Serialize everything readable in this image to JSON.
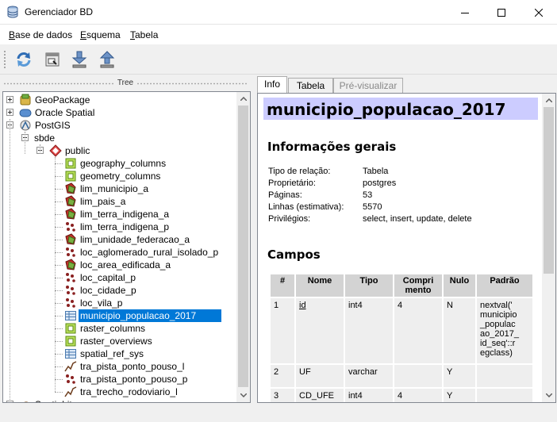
{
  "window": {
    "title": "Gerenciador BD"
  },
  "menu": {
    "items": [
      {
        "label": "Base de dados",
        "mnemonic": "B",
        "rest": "ase de dados"
      },
      {
        "label": "Esquema",
        "mnemonic": "E",
        "rest": "squema"
      },
      {
        "label": "Tabela",
        "mnemonic": "T",
        "rest": "abela"
      }
    ]
  },
  "toolbar": {
    "buttons": [
      "refresh-icon",
      "sql-window-icon",
      "import-icon",
      "export-icon"
    ]
  },
  "tree": {
    "header": "Tree",
    "items": [
      {
        "label": "GeoPackage",
        "icon": "geopackage-icon"
      },
      {
        "label": "Oracle Spatial",
        "icon": "oracle-icon"
      },
      {
        "label": "PostGIS",
        "icon": "postgis-icon"
      },
      {
        "label": "sbde",
        "icon": "connection"
      },
      {
        "label": "public",
        "icon": "schema-icon"
      },
      {
        "label": "geography_columns",
        "icon": "view-icon"
      },
      {
        "label": "geometry_columns",
        "icon": "view-icon"
      },
      {
        "label": "lim_municipio_a",
        "icon": "polygon-layer-icon"
      },
      {
        "label": "lim_pais_a",
        "icon": "polygon-layer-icon"
      },
      {
        "label": "lim_terra_indigena_a",
        "icon": "polygon-layer-icon"
      },
      {
        "label": "lim_terra_indigena_p",
        "icon": "point-layer-icon"
      },
      {
        "label": "lim_unidade_federacao_a",
        "icon": "polygon-layer-icon"
      },
      {
        "label": "loc_aglomerado_rural_isolado_p",
        "icon": "point-layer-icon"
      },
      {
        "label": "loc_area_edificada_a",
        "icon": "polygon-layer-icon"
      },
      {
        "label": "loc_capital_p",
        "icon": "point-layer-icon"
      },
      {
        "label": "loc_cidade_p",
        "icon": "point-layer-icon"
      },
      {
        "label": "loc_vila_p",
        "icon": "point-layer-icon"
      },
      {
        "label": "municipio_populacao_2017",
        "icon": "table-icon"
      },
      {
        "label": "raster_columns",
        "icon": "view-icon"
      },
      {
        "label": "raster_overviews",
        "icon": "view-icon"
      },
      {
        "label": "spatial_ref_sys",
        "icon": "table-icon"
      },
      {
        "label": "tra_pista_ponto_pouso_l",
        "icon": "line-layer-icon"
      },
      {
        "label": "tra_pista_ponto_pouso_p",
        "icon": "point-layer-icon"
      },
      {
        "label": "tra_trecho_rodoviario_l",
        "icon": "line-layer-icon"
      },
      {
        "label": "SpatiaLite",
        "icon": "spatialite-icon"
      }
    ]
  },
  "tabs": [
    {
      "label": "Info"
    },
    {
      "label": "Tabela"
    },
    {
      "label": "Pré-visualizar"
    }
  ],
  "info": {
    "title": "municipio_populacao_2017",
    "general_heading": "Informações gerais",
    "general": [
      {
        "label": "Tipo de relação:",
        "value": "Tabela"
      },
      {
        "label": "Proprietário:",
        "value": "postgres"
      },
      {
        "label": "Páginas:",
        "value": "53"
      },
      {
        "label": "Linhas (estimativa):",
        "value": "5570"
      },
      {
        "label": "Privilégios:",
        "value": "select, insert, update, delete"
      }
    ],
    "fields_heading": "Campos",
    "field_headers": [
      "#",
      "Nome",
      "Tipo",
      "Compri mento",
      "Nulo",
      "Padrão"
    ],
    "field_header_lines": {
      "comp_1": "Compri",
      "comp_2": "mento"
    },
    "fields": [
      {
        "n": "1",
        "nome": "id",
        "tipo": "int4",
        "comp": "4",
        "nulo": "N",
        "padrao": "nextval('municipio_populacao_2017_id_seq'::regclass)",
        "padrao_lines": [
          "nextval('",
          "municipio",
          "_populac",
          "ao_2017_",
          "id_seq'::r",
          "egclass)"
        ]
      },
      {
        "n": "2",
        "nome": "UF",
        "tipo": "varchar",
        "comp": "",
        "nulo": "Y",
        "padrao": ""
      },
      {
        "n": "3",
        "nome": "CD_UFE",
        "tipo": "int4",
        "comp": "4",
        "nulo": "Y",
        "padrao": ""
      }
    ]
  },
  "colors": {
    "selection": "#0078d7",
    "title_band": "#ccccff",
    "table_header": "#d3d3d3",
    "table_cell": "#eeeeee"
  }
}
